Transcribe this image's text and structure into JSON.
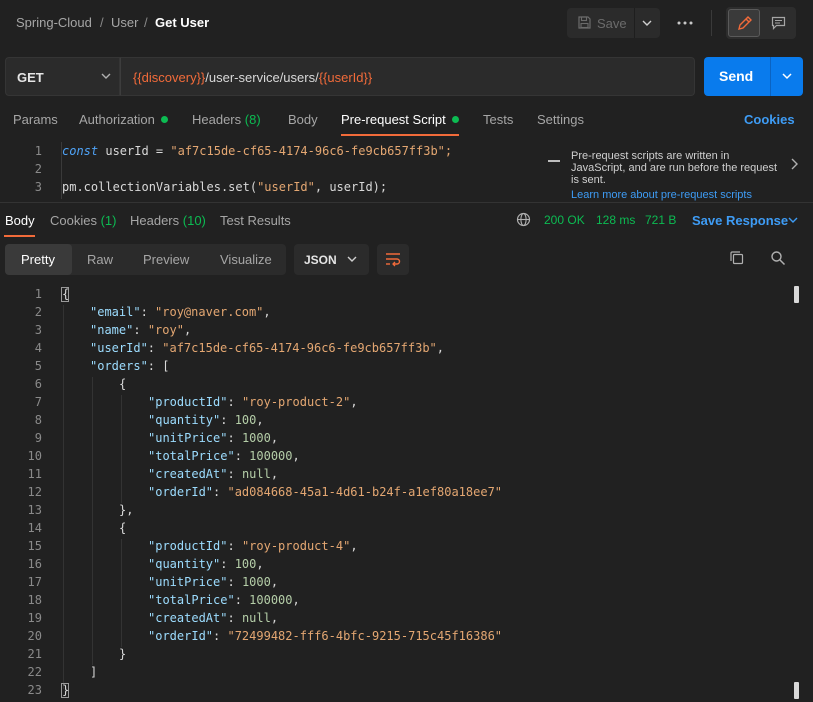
{
  "breadcrumb": {
    "collection": "Spring-Cloud",
    "folder": "User",
    "request": "Get User",
    "sep": "/"
  },
  "toolbar": {
    "save_label": "Save"
  },
  "request": {
    "method": "GET",
    "url_parts": [
      {
        "text": "{{discovery}}",
        "type": "var"
      },
      {
        "text": "/user-service/users/",
        "type": "plain"
      },
      {
        "text": "{{userId}}",
        "type": "var"
      }
    ],
    "send_label": "Send"
  },
  "request_tabs": {
    "params": "Params",
    "authorization": "Authorization",
    "headers": "Headers",
    "headers_count": "(8)",
    "body": "Body",
    "prerequest": "Pre-request Script",
    "tests": "Tests",
    "settings": "Settings",
    "cookies": "Cookies"
  },
  "script": {
    "lines": [
      "1",
      "2",
      "3"
    ],
    "line1_kw": "const",
    "line1_mid": " userId = ",
    "line1_str": "\"af7c15de-cf65-4174-96c6-fe9cb657ff3b\";",
    "line3_a": "pm.collectionVariables.set(",
    "line3_str": "\"userId\"",
    "line3_b": ", userId);",
    "hint_text": "Pre-request scripts are written in JavaScript, and are run before the request is sent.",
    "hint_link": "Learn more about pre-request scripts"
  },
  "response_tabs": {
    "body": "Body",
    "cookies": "Cookies",
    "cookies_count": "(1)",
    "headers": "Headers",
    "headers_count": "(10)",
    "test_results": "Test Results"
  },
  "response_meta": {
    "status": "200 OK",
    "time": "128 ms",
    "size": "721 B",
    "save_response": "Save Response"
  },
  "format": {
    "pretty": "Pretty",
    "raw": "Raw",
    "preview": "Preview",
    "visualize": "Visualize",
    "language": "JSON"
  },
  "response_body": {
    "line_numbers": [
      "1",
      "2",
      "3",
      "4",
      "5",
      "6",
      "7",
      "8",
      "9",
      "10",
      "11",
      "12",
      "13",
      "14",
      "15",
      "16",
      "17",
      "18",
      "19",
      "20",
      "21",
      "22",
      "23"
    ],
    "open_brace": "{",
    "close_brace": "}",
    "email_key": "\"email\"",
    "email_val": "\"roy@naver.com\"",
    "name_key": "\"name\"",
    "name_val": "\"roy\"",
    "userId_key": "\"userId\"",
    "userId_val": "\"af7c15de-cf65-4174-96c6-fe9cb657ff3b\"",
    "orders_key": "\"orders\"",
    "orders": [
      {
        "productId": "\"roy-product-2\"",
        "quantity": "100",
        "unitPrice": "1000",
        "totalPrice": "100000",
        "createdAt": "null",
        "orderId": "\"ad084668-45a1-4d61-b24f-a1ef80a18ee7\""
      },
      {
        "productId": "\"roy-product-4\"",
        "quantity": "100",
        "unitPrice": "1000",
        "totalPrice": "100000",
        "createdAt": "null",
        "orderId": "\"72499482-fff6-4bfc-9215-715c45f16386\""
      }
    ],
    "keys": {
      "productId": "\"productId\"",
      "quantity": "\"quantity\"",
      "unitPrice": "\"unitPrice\"",
      "totalPrice": "\"totalPrice\"",
      "createdAt": "\"createdAt\"",
      "orderId": "\"orderId\""
    }
  },
  "colors": {
    "accent": "#f26b3a",
    "primary": "#097bed",
    "success": "#0cbb52",
    "link": "#3e9cf5",
    "background": "#212121"
  }
}
